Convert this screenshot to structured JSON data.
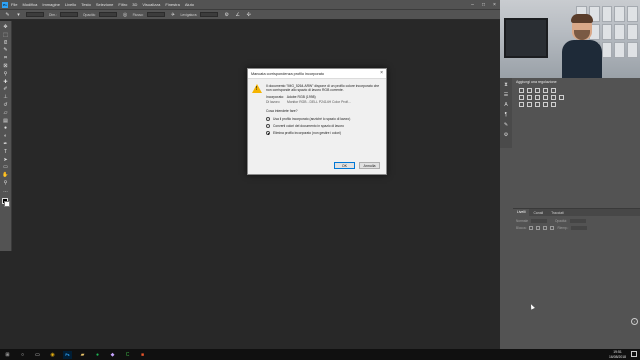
{
  "app": {
    "name": "Photoshop",
    "logo": "Ps"
  },
  "menubar": {
    "items": [
      "File",
      "Modifica",
      "Immagine",
      "Livello",
      "Testo",
      "Selezione",
      "Filtro",
      "3D",
      "Visualizza",
      "Finestra",
      "Aiuto"
    ]
  },
  "optionsbar": {
    "labels": [
      "Dim.:",
      "Opacità:",
      "Flusso:",
      "Levigatura:"
    ],
    "icons": [
      "brush-icon",
      "settings-icon",
      "airbrush-icon",
      "angle-icon",
      "pressure-icon",
      "symmetry-icon"
    ]
  },
  "toolbar": {
    "tools": [
      "move-icon",
      "marquee-icon",
      "lasso-icon",
      "quick-select-icon",
      "crop-icon",
      "frame-icon",
      "eyedropper-icon",
      "healing-icon",
      "brush-icon",
      "clone-stamp-icon",
      "history-brush-icon",
      "eraser-icon",
      "gradient-icon",
      "blur-icon",
      "dodge-icon",
      "pen-icon",
      "type-icon",
      "path-select-icon",
      "rectangle-icon",
      "hand-icon",
      "zoom-icon",
      "more-icon"
    ]
  },
  "panels": {
    "adjustments_title": "Aggiungi una regolazione",
    "layers_tabs": [
      "Livelli",
      "Canali",
      "Tracciati"
    ],
    "layers_labels": [
      "Normale",
      "Opacità:",
      "Blocca:",
      "Riemp.:"
    ]
  },
  "dialog": {
    "title": "Mancata corrispondenza profilo incorporato",
    "message": "Il documento \"IMG_5264.ARW\" dispone di un profilo colore incorporato che non corrisponde allo spazio di lavoro RGB corrente.",
    "embedded_label": "Incorporato:",
    "embedded_value": "Adobe RGB (1998)",
    "working_label": "Di lavoro:",
    "working_value": "Monitor RGB - DELL P2414H Color Profi...",
    "question": "Cosa intendete fare?",
    "options": [
      {
        "label": "Usa il profilo incorporato (anziché lo spazio di lavoro)",
        "selected": false
      },
      {
        "label": "Converti colori del documento in spazio di lavoro",
        "selected": false
      },
      {
        "label": "Elimina profilo incorporato (non gestire i colori)",
        "selected": true
      }
    ],
    "ok_label": "OK",
    "cancel_label": "Annulla"
  },
  "taskbar": {
    "time": "19:51",
    "date": "16/08/2018",
    "icons": [
      "start-icon",
      "search-icon",
      "task-view-icon",
      "chrome-icon",
      "photoshop-icon",
      "files-icon",
      "spotify-icon",
      "app-icon",
      "camtasia-icon",
      "office-icon"
    ]
  }
}
